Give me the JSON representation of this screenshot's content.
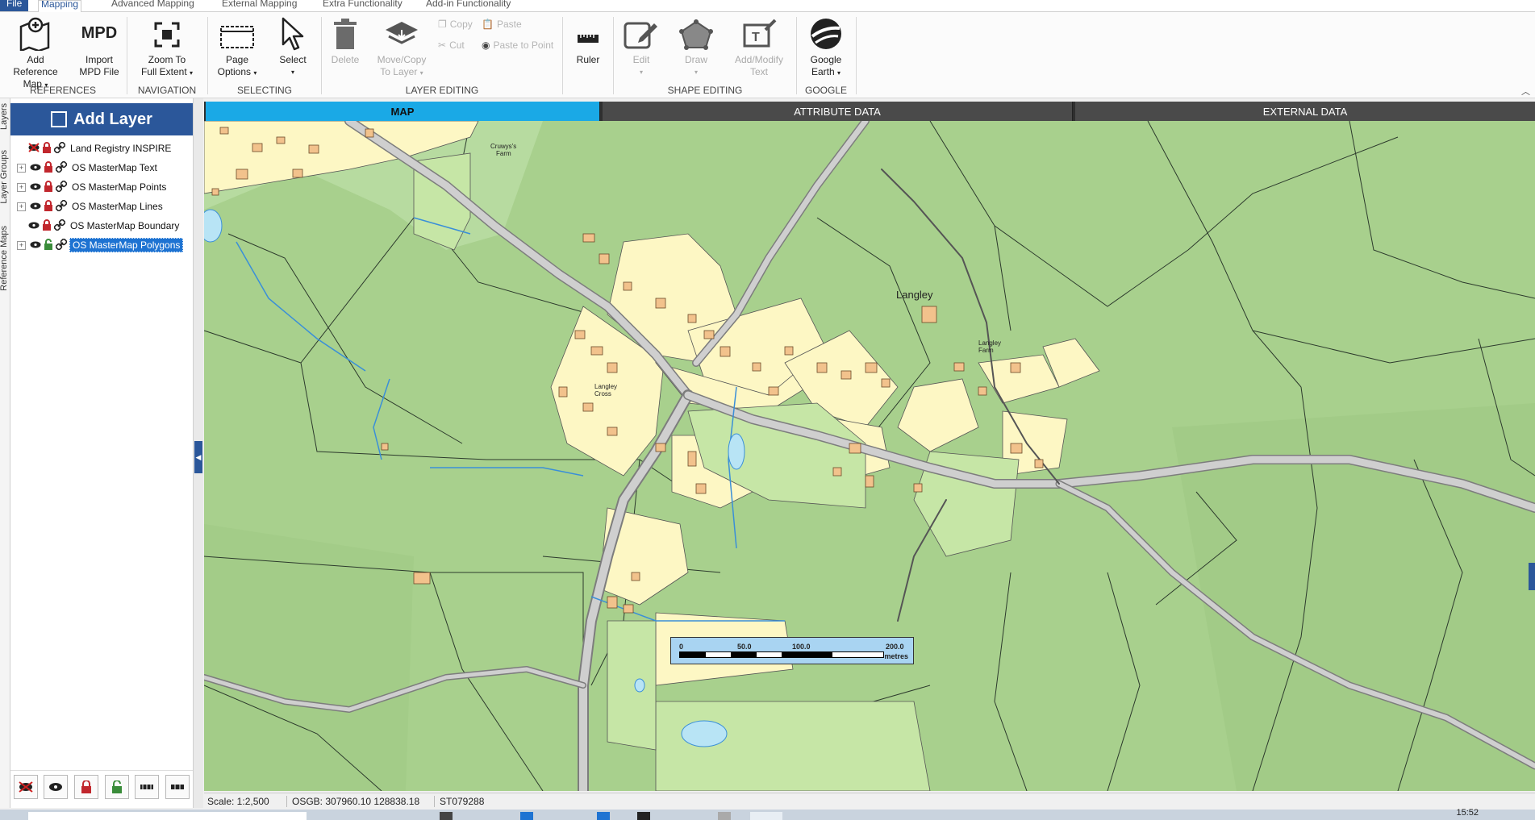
{
  "ribbon_tabs": [
    "File",
    "Mapping",
    "Advanced Mapping",
    "External Mapping",
    "Extra Functionality",
    "Add-in Functionality"
  ],
  "ribbon": {
    "references": {
      "label": "REFERENCES",
      "add_reference_map": [
        "Add Reference",
        "Map"
      ],
      "import_mpd": [
        "Import",
        "MPD File"
      ],
      "mpd_glyph": "MPD"
    },
    "navigation": {
      "label": "NAVIGATION",
      "zoom_full_extent": [
        "Zoom To",
        "Full Extent"
      ]
    },
    "selecting": {
      "label": "SELECTING",
      "page_options": [
        "Page",
        "Options"
      ],
      "select": "Select"
    },
    "layer_editing": {
      "label": "LAYER EDITING",
      "delete": "Delete",
      "move_copy": [
        "Move/Copy",
        "To Layer"
      ],
      "copy": "Copy",
      "paste": "Paste",
      "cut": "Cut",
      "paste_to_point": "Paste to Point"
    },
    "ruler": "Ruler",
    "shape_editing": {
      "label": "SHAPE EDITING",
      "edit": "Edit",
      "draw": "Draw",
      "add_modify_text": [
        "Add/Modify",
        "Text"
      ]
    },
    "google": {
      "label": "GOOGLE",
      "google_earth": [
        "Google",
        "Earth"
      ]
    }
  },
  "side_tabs": [
    "Layers",
    "Layer Groups",
    "Reference Maps"
  ],
  "layer_panel": {
    "add_layer": "Add Layer",
    "layers": [
      {
        "name": "Land Registry INSPIRE",
        "expandable": false,
        "visible": false,
        "locked": true,
        "selected": false
      },
      {
        "name": "OS MasterMap Text",
        "expandable": true,
        "visible": true,
        "locked": true,
        "selected": false
      },
      {
        "name": "OS MasterMap Points",
        "expandable": true,
        "visible": true,
        "locked": true,
        "selected": false
      },
      {
        "name": "OS MasterMap Lines",
        "expandable": true,
        "visible": true,
        "locked": true,
        "selected": false
      },
      {
        "name": "OS MasterMap Boundary",
        "expandable": false,
        "visible": true,
        "locked": true,
        "selected": false
      },
      {
        "name": "OS MasterMap Polygons",
        "expandable": true,
        "visible": true,
        "locked": false,
        "selected": true
      }
    ]
  },
  "map_tabs": [
    "MAP",
    "ATTRIBUTE DATA",
    "EXTERNAL DATA"
  ],
  "map": {
    "labels": {
      "langley": "Langley",
      "langley_cross": [
        "Langley",
        "Cross"
      ],
      "langley_farm": [
        "Langley",
        "Farm"
      ],
      "cruwys_farm": [
        "Cruwys's",
        "Farm"
      ]
    },
    "scale_bar": {
      "ticks": [
        "0",
        "50.0",
        "100.0",
        "200.0"
      ],
      "unit": "metres"
    }
  },
  "status": {
    "scale": "Scale: 1:2,500",
    "coords": "OSGB: 307960.10  128838.18",
    "grid_ref": "ST079288"
  },
  "taskbar": {
    "clock": "15:52"
  },
  "colors": {
    "accent": "#2b579a",
    "tab_active": "#1aa9e6",
    "field": "#a8d08d",
    "urban": "#fdf7c4",
    "building": "#f2c28c",
    "road": "#c0c0c0"
  }
}
